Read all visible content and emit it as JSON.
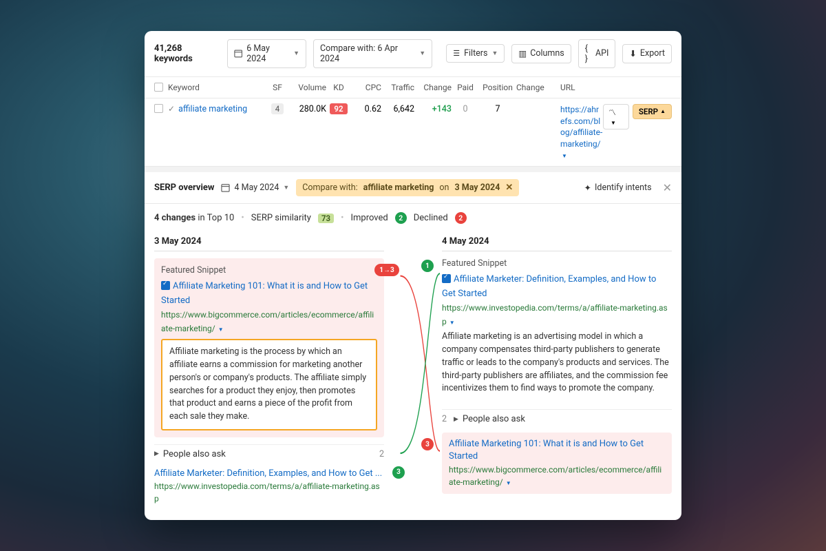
{
  "toolbar": {
    "keywords_count": "41,268 keywords",
    "date": "6 May 2024",
    "compare_label": "Compare with: 6 Apr 2024",
    "filters": "Filters",
    "columns": "Columns",
    "api": "API",
    "export": "Export"
  },
  "columns": {
    "keyword": "Keyword",
    "sf": "SF",
    "volume": "Volume",
    "kd": "KD",
    "cpc": "CPC",
    "traffic": "Traffic",
    "change": "Change",
    "paid": "Paid",
    "position": "Position",
    "change2": "Change",
    "url": "URL"
  },
  "row": {
    "keyword": "affiliate marketing",
    "sf": "4",
    "volume": "280.0K",
    "kd": "92",
    "cpc": "0.62",
    "traffic": "6,642",
    "change": "+143",
    "paid": "0",
    "position": "7",
    "url": "https://ahrefs.com/blog/affiliate-marketing/",
    "serp": "SERP"
  },
  "serp_overview": {
    "title": "SERP overview",
    "date": "4 May 2024",
    "compare_prefix": "Compare with:",
    "compare_kw": "affiliate marketing",
    "compare_on": "on",
    "compare_date": "3 May 2024",
    "identify": "Identify intents"
  },
  "changes": {
    "count_label": "4 changes",
    "in_top": "in Top 10",
    "similarity_label": "SERP similarity",
    "similarity": "73",
    "improved_label": "Improved",
    "improved": "2",
    "declined_label": "Declined",
    "declined": "2"
  },
  "left": {
    "date": "3 May 2024",
    "fs_label": "Featured Snippet",
    "title": "Affiliate Marketing 101: What it is and How to Get Started",
    "url": "https://www.bigcommerce.com/articles/ecommerce/affiliate-marketing/",
    "desc": "Affiliate marketing is the process by which an affiliate earns a commission for marketing another person's or company's products. The affiliate simply searches for a product they enjoy, then promotes that product and earns a piece of the profit from each sale they make.",
    "paa": "People also ask",
    "paa_num": "2",
    "r3_title": "Affiliate Marketer: Definition, Examples, and How to Get ...",
    "r3_url": "https://www.investopedia.com/terms/a/affiliate-marketing.asp",
    "badge1": "1→3",
    "badge3": "3"
  },
  "right": {
    "date": "4 May 2024",
    "fs_label": "Featured Snippet",
    "title": "Affiliate Marketer: Definition, Examples, and How to Get Started",
    "url": "https://www.investopedia.com/terms/a/affiliate-marketing.asp",
    "desc": "Affiliate marketing is an advertising model in which a company compensates third-party publishers to generate traffic or leads to the company's products and services. The third-party publishers are affiliates, and the commission fee incentivizes them to find ways to promote the company.",
    "paa": "People also ask",
    "paa_num": "2",
    "r3_title": "Affiliate Marketing 101: What it is and How to Get Started",
    "r3_url": "https://www.bigcommerce.com/articles/ecommerce/affiliate-marketing/",
    "badge1": "1",
    "badge3": "3"
  }
}
